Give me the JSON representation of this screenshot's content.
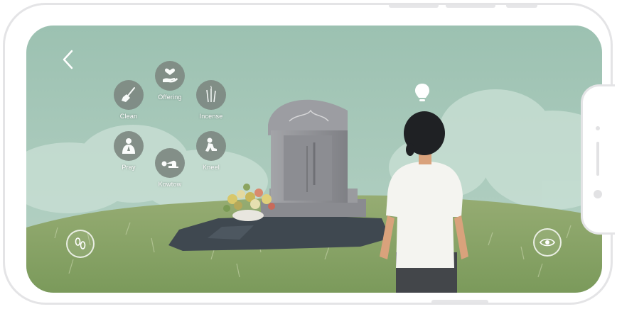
{
  "actions": [
    {
      "id": "clean",
      "label": "Clean",
      "icon": "broom-icon"
    },
    {
      "id": "offering",
      "label": "Offering",
      "icon": "heart-in-hand-icon"
    },
    {
      "id": "incense",
      "label": "Incense",
      "icon": "incense-sticks-icon"
    },
    {
      "id": "pray",
      "label": "Pray",
      "icon": "praying-person-icon"
    },
    {
      "id": "kowtow",
      "label": "Kowtow",
      "icon": "kowtow-person-icon"
    },
    {
      "id": "kneel",
      "label": "Kneel",
      "icon": "kneeling-person-icon"
    }
  ],
  "controls": {
    "back": "chevron-left-icon",
    "walk": "footprints-icon",
    "view": "eye-icon",
    "hint": "lightbulb-icon"
  },
  "colors": {
    "sky": "#9dc0b1",
    "grass": "#8ea56a",
    "tombstone": "#8f9094",
    "action_button": "#7e8983",
    "shirt": "#f3f3ef"
  }
}
